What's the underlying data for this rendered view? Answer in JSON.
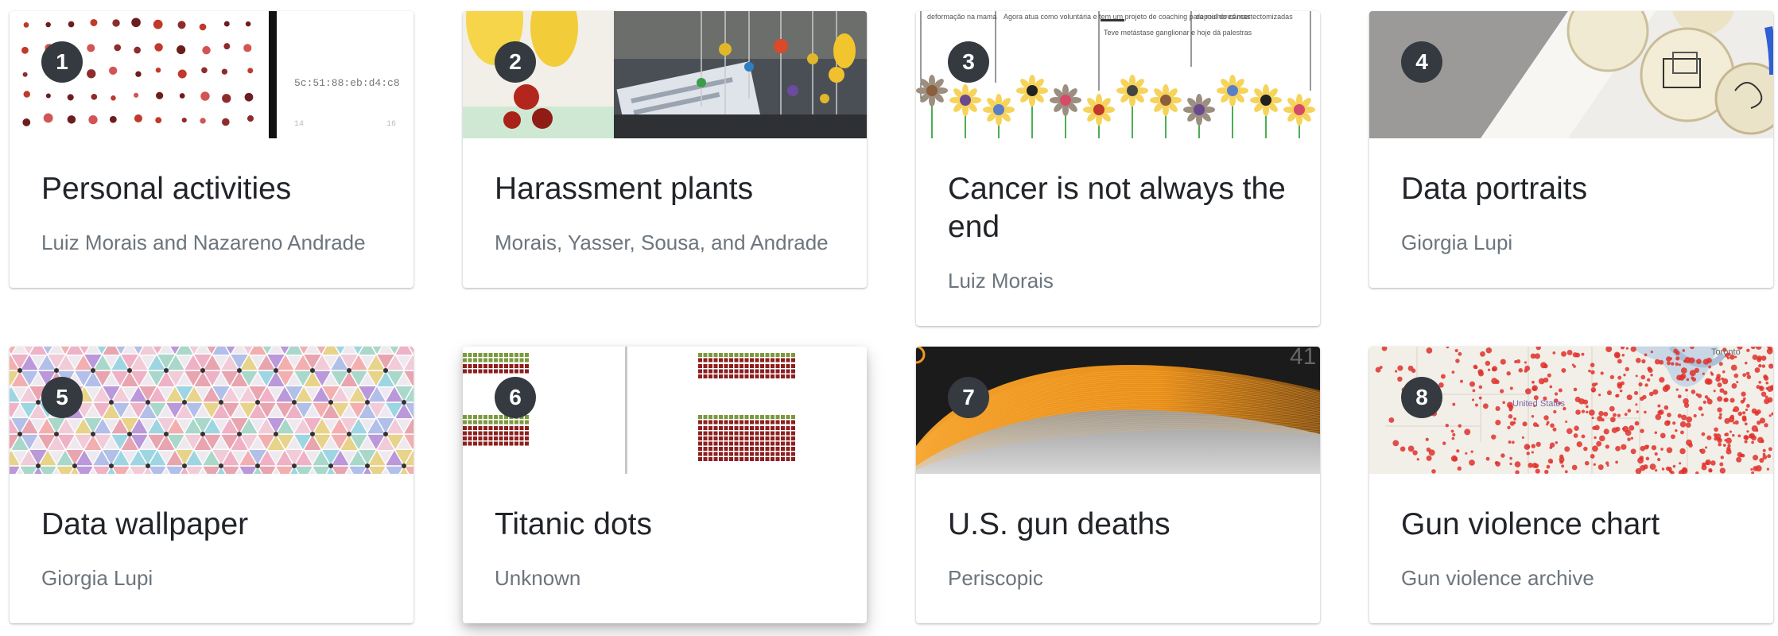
{
  "cards": [
    {
      "number": "1",
      "title": "Personal activities",
      "author": "Luiz Morais and Nazareno Andrade",
      "thumb_label": "5c:51:88:eb:d4:c8",
      "thumb_axis_left": "14",
      "thumb_axis_right": "16"
    },
    {
      "number": "2",
      "title": "Harassment plants",
      "author": "Morais, Yasser, Sousa, and Andrade"
    },
    {
      "number": "3",
      "title": "Cancer is not always the end",
      "author": "Luiz Morais",
      "thumb_texts": [
        "deformação na mama",
        "Agora atua como voluntária e tem um projeto de coaching para mulheres mastectomizadas",
        "Teve metástase ganglionar e hoje dá palestras",
        "depois do câncer"
      ]
    },
    {
      "number": "4",
      "title": "Data portraits",
      "author": "Giorgia Lupi"
    },
    {
      "number": "5",
      "title": "Data wallpaper",
      "author": "Giorgia Lupi"
    },
    {
      "number": "6",
      "title": "Titanic dots",
      "author": "Unknown"
    },
    {
      "number": "7",
      "title": "U.S. gun deaths",
      "author": "Periscopic",
      "thumb_counter": "41"
    },
    {
      "number": "8",
      "title": "Gun violence chart",
      "author": "Gun violence archive",
      "thumb_map_labels": [
        "Toronto",
        "United States"
      ]
    }
  ],
  "colors": {
    "badge_bg": "#343a40",
    "title_text": "#212529",
    "author_text": "#6c757d",
    "titanic_green": "#7b9a3c",
    "titanic_red": "#8e1f1f",
    "gun_orange": "#f39a1e",
    "map_dot": "#e0302a"
  }
}
